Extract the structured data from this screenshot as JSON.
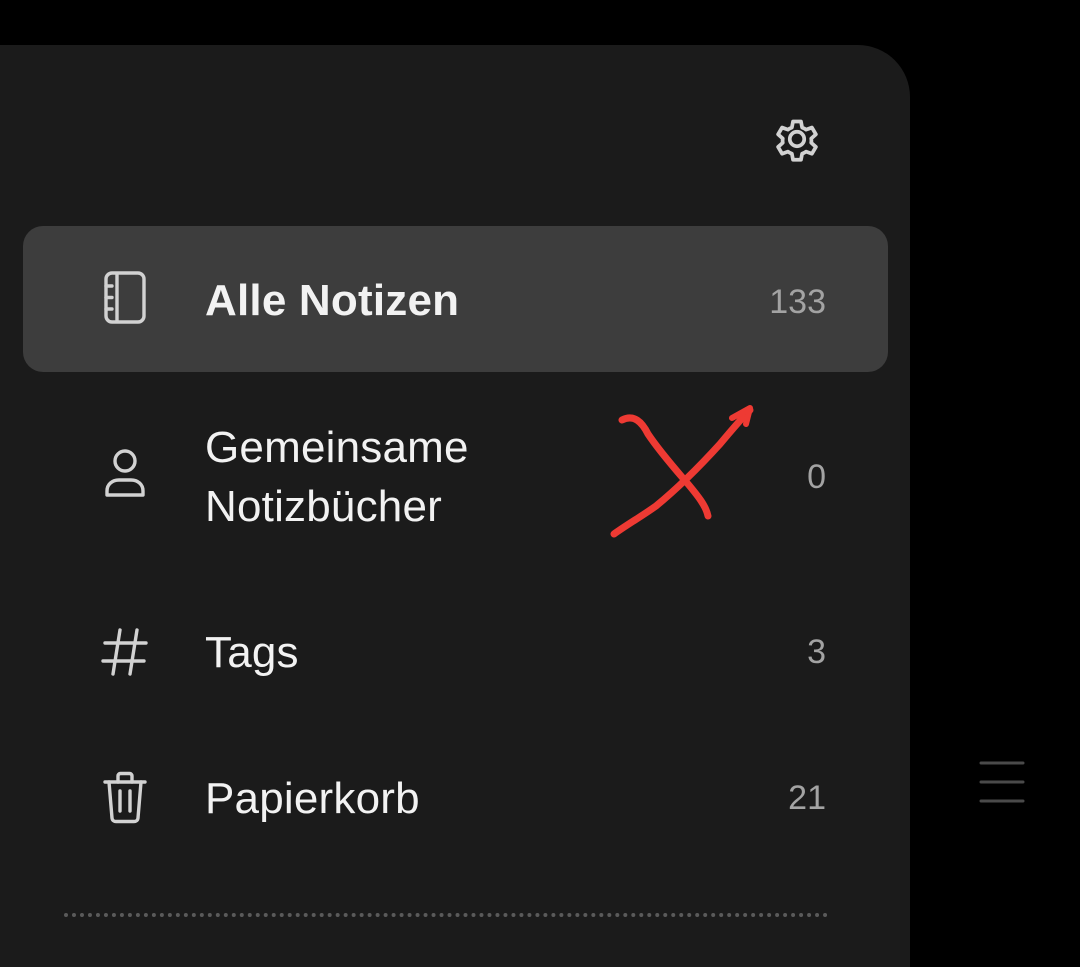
{
  "drawer": {
    "settings_icon": "gear-icon",
    "items": [
      {
        "label": "Alle Notizen",
        "count": "133",
        "icon": "notebook-icon",
        "active": true
      },
      {
        "label": "Gemeinsame Notizbücher",
        "label_line1": "Gemeinsame",
        "label_line2": "Notizbücher",
        "count": "0",
        "icon": "person-icon",
        "active": false
      },
      {
        "label": "Tags",
        "count": "3",
        "icon": "hashtag-icon",
        "active": false
      },
      {
        "label": "Papierkorb",
        "count": "21",
        "icon": "trash-icon",
        "active": false
      }
    ]
  },
  "background_screen": {
    "menu_icon": "hamburger-menu-icon"
  },
  "annotation": {
    "type": "hand-drawn-cross",
    "color": "#ee3a33"
  },
  "colors": {
    "background": "#000000",
    "drawer_background": "#1b1b1b",
    "active_item_background": "#3d3d3d",
    "text_primary": "#f2f2f2",
    "text_secondary": "#a3a3a3",
    "annotation": "#ee3a33"
  }
}
